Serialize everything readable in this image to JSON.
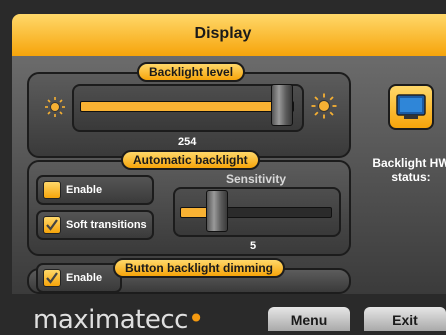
{
  "window": {
    "title": "Display"
  },
  "backlight": {
    "label": "Backlight level",
    "value": "254",
    "fraction": 0.996
  },
  "auto_backlight": {
    "label": "Automatic backlight",
    "enable_label": "Enable",
    "enable_checked": false,
    "soft_label": "Soft transitions",
    "soft_checked": true,
    "sensitivity_label": "Sensitivity",
    "sensitivity_value": "5",
    "sensitivity_fraction": 0.2
  },
  "button_dimming": {
    "label": "Button backlight dimming",
    "enable_label": "Enable",
    "enable_checked": true
  },
  "hw_status": {
    "label_line1": "Backlight HW",
    "label_line2": "status:"
  },
  "footer": {
    "brand_text": "maximatecc",
    "menu_label": "Menu",
    "exit_label": "Exit"
  },
  "colors": {
    "accent": "#f6a40a",
    "accent_light": "#ffd86a",
    "panel": "#4a4a4a"
  },
  "icons": [
    "sun-dim-icon",
    "sun-bright-icon",
    "monitor-icon",
    "checkmark-icon"
  ]
}
